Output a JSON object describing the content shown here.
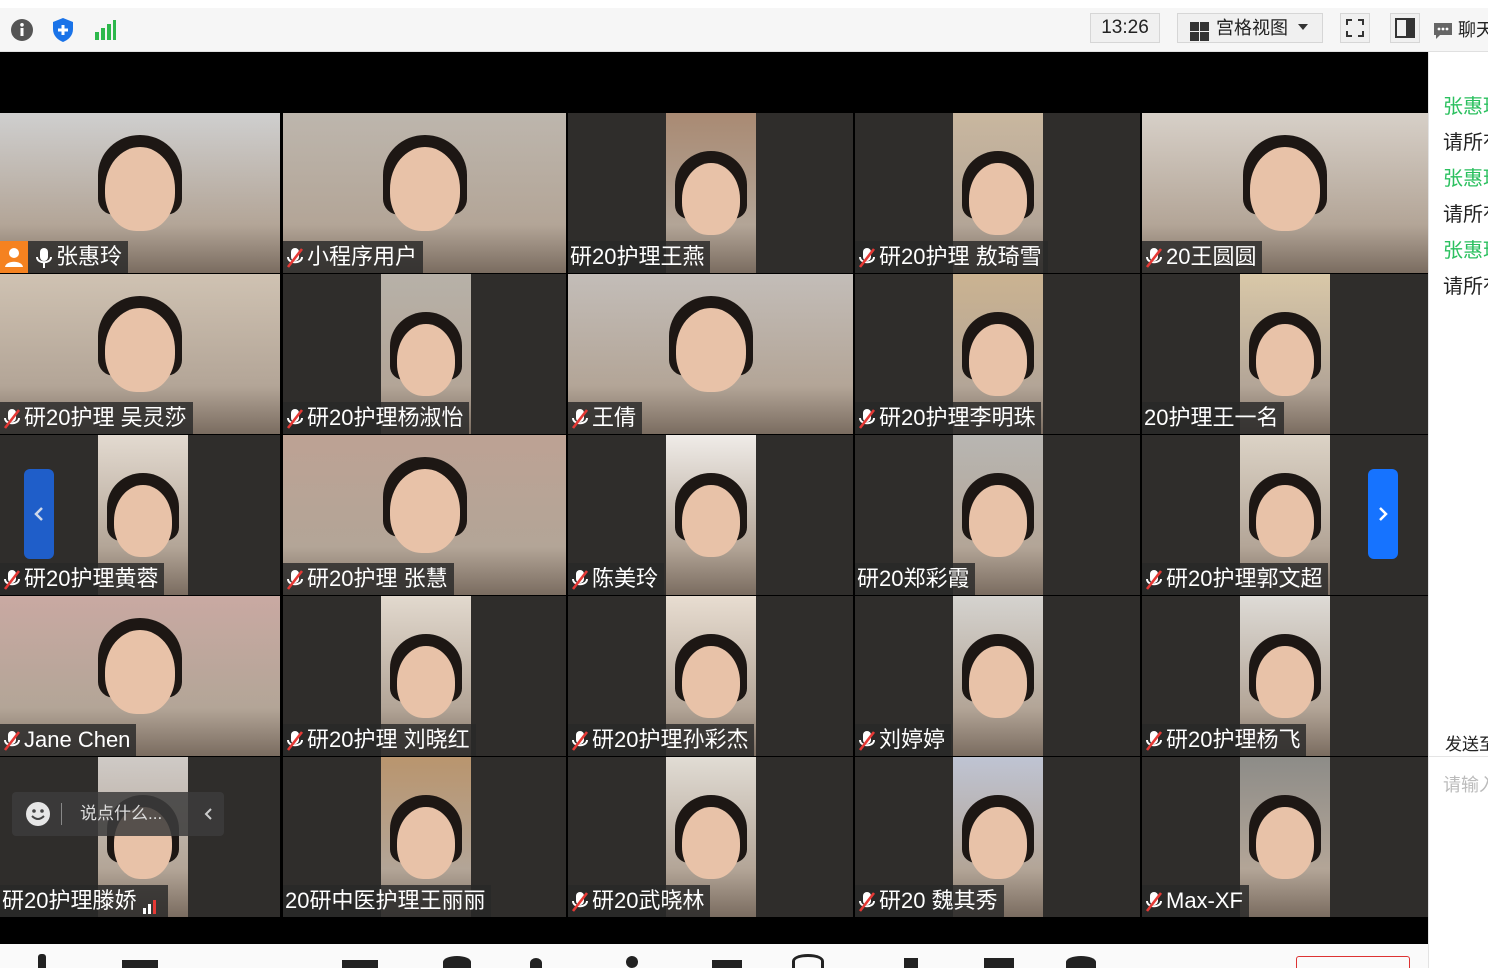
{
  "toolbar": {
    "clock": "13:26",
    "view_label": "宫格视图",
    "chat_label": "聊天",
    "colors": {
      "info": "#555555",
      "shield": "#1a73e8",
      "signal": "#2db84c"
    }
  },
  "tiles": [
    {
      "name": "张惠玲",
      "icon": "mic-on",
      "host": true
    },
    {
      "name": "小程序用户",
      "icon": "mic-off"
    },
    {
      "name": "研20护理王燕",
      "icon": "none"
    },
    {
      "name": "研20护理  敖琦雪",
      "icon": "mic-off"
    },
    {
      "name": "20王圆圆",
      "icon": "mic-off"
    },
    {
      "name": "研20护理 吴灵莎",
      "icon": "mic-off"
    },
    {
      "name": "研20护理杨淑怡",
      "icon": "mic-off"
    },
    {
      "name": "王倩",
      "icon": "mic-off"
    },
    {
      "name": "研20护理李明珠",
      "icon": "mic-off"
    },
    {
      "name": "20护理王一名",
      "icon": "none"
    },
    {
      "name": "研20护理黄蓉",
      "icon": "mic-off"
    },
    {
      "name": "研20护理 张慧",
      "icon": "mic-off"
    },
    {
      "name": "陈美玲",
      "icon": "mic-off"
    },
    {
      "name": "研20郑彩霞",
      "icon": "none"
    },
    {
      "name": "研20护理郭文超",
      "icon": "mic-off"
    },
    {
      "name": "Jane  Chen",
      "icon": "mic-off"
    },
    {
      "name": "研20护理  刘晓红",
      "icon": "mic-off"
    },
    {
      "name": "研20护理孙彩杰",
      "icon": "mic-off"
    },
    {
      "name": "刘婷婷",
      "icon": "mic-off"
    },
    {
      "name": "研20护理杨飞",
      "icon": "mic-off"
    },
    {
      "name": "研20护理滕娇",
      "icon": "signal"
    },
    {
      "name": "20研中医护理王丽丽",
      "icon": "none"
    },
    {
      "name": "研20武晓林",
      "icon": "mic-off"
    },
    {
      "name": "研20 魏其秀",
      "icon": "mic-off"
    },
    {
      "name": "Max-XF",
      "icon": "mic-off"
    }
  ],
  "say_box": {
    "placeholder": "说点什么..."
  },
  "chat": {
    "messages": [
      {
        "sender": "张惠玲",
        "text": "请所有"
      },
      {
        "sender": "张惠玲",
        "text": "请所有"
      },
      {
        "sender": "张惠玲",
        "text": "请所有"
      }
    ],
    "send_to": "发送至",
    "input_placeholder": "请输入"
  }
}
